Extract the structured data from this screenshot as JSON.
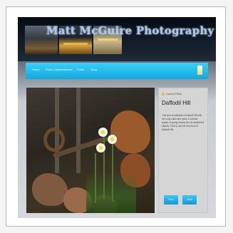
{
  "site": {
    "logo_text": "Matt McGuire Photography",
    "nav": {
      "items": [
        "Home",
        "Photo Galleries",
        "About",
        "Prints",
        "Blog"
      ]
    },
    "sidebar": {
      "label": "Current Photo",
      "title": "Daffodil Hill",
      "description": "This shot of daffodils at Daffodil Hill with the rusty chain and rocks. A colorful splash of spring among the old weathered objects. Click to see the full photo of Daffodil Hill.",
      "buttons": [
        "Prev",
        "Next"
      ]
    }
  },
  "colors": {
    "nav_accent": "#1ab2e6",
    "logo": "#a9c9ec",
    "flower_center": "#e9d84c"
  }
}
